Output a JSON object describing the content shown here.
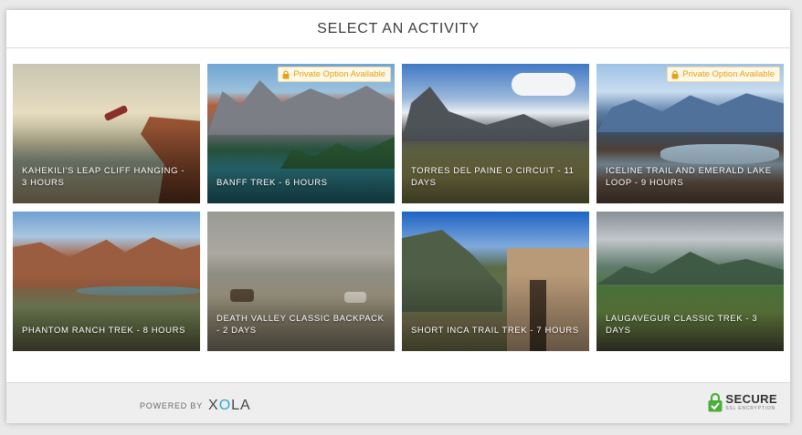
{
  "header": {
    "title": "SELECT AN ACTIVITY"
  },
  "activities": [
    {
      "title": "KAHEKILI'S LEAP CLIFF HANGING - 3 HOURS",
      "private": false
    },
    {
      "title": "BANFF TREK - 6 HOURS",
      "private": true
    },
    {
      "title": "TORRES DEL PAINE O CIRCUIT - 11 DAYS",
      "private": false
    },
    {
      "title": "ICELINE TRAIL AND EMERALD LAKE LOOP - 9 HOURS",
      "private": true
    },
    {
      "title": "PHANTOM RANCH TREK - 8 HOURS",
      "private": false
    },
    {
      "title": "DEATH VALLEY CLASSIC BACKPACK - 2 DAYS",
      "private": false
    },
    {
      "title": "SHORT INCA TRAIL TREK - 7 HOURS",
      "private": false
    },
    {
      "title": "LAUGAVEGUR CLASSIC TREK - 3 DAYS",
      "private": false
    }
  ],
  "badge": {
    "label": "Private Option Available",
    "color": "#e3a21a"
  },
  "footer": {
    "powered_by": "POWERED BY",
    "brand_x": "X",
    "brand_o": "O",
    "brand_la": "LA",
    "secure": "SECURE",
    "secure_sub": "SSL ENCRYPTION"
  },
  "colors": {
    "secure_green": "#4cae3a",
    "brand_accent": "#2aa8d8"
  }
}
